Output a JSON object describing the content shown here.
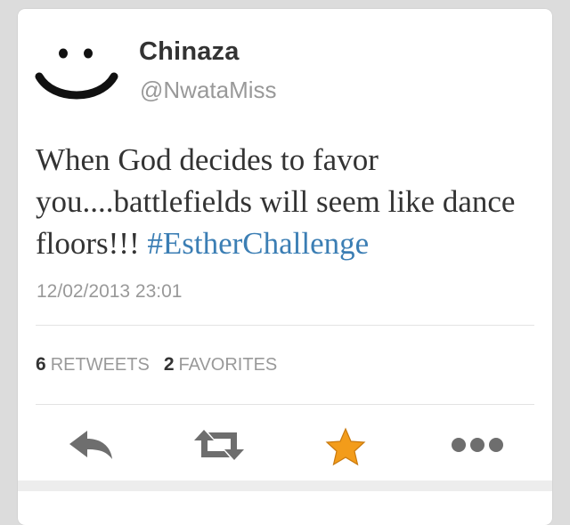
{
  "user": {
    "name": "Chinaza",
    "handle": "@NwataMiss",
    "avatar_icon": "smiley-face-icon"
  },
  "tweet": {
    "text": "When God decides to favor you....battlefields will seem like dance floors!!! ",
    "hashtag": "#EstherChallenge",
    "timestamp": "12/02/2013 23:01"
  },
  "stats": {
    "retweets_count": "6",
    "retweets_label": "RETWEETS",
    "favorites_count": "2",
    "favorites_label": "FAVORITES"
  },
  "actions": {
    "reply_icon": "reply-arrow-icon",
    "retweet_icon": "retweet-icon",
    "favorite_icon": "star-icon",
    "more_icon": "more-dots-icon"
  },
  "colors": {
    "hashtag": "#3b7eb4",
    "favorite_star": "#f39c1a",
    "icon_gray": "#6e6e6e",
    "muted_text": "#999999"
  }
}
